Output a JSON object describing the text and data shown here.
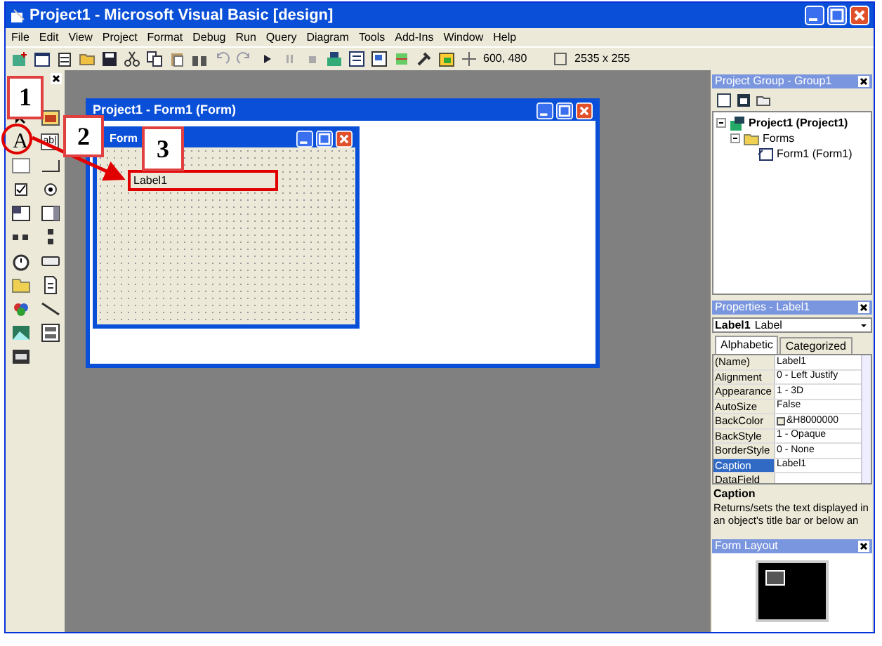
{
  "window": {
    "title": "Project1 - Microsoft Visual Basic [design]"
  },
  "menu": [
    "File",
    "Edit",
    "View",
    "Project",
    "Format",
    "Debug",
    "Run",
    "Query",
    "Diagram",
    "Tools",
    "Add-Ins",
    "Window",
    "Help"
  ],
  "toolbar": {
    "position": "600, 480",
    "size": "2535 x 255"
  },
  "toolbox": {
    "label_tool": "A",
    "textbox_tool": "ab|"
  },
  "designer": {
    "title": "Project1 - Form1 (Form)",
    "form": {
      "title": "Form",
      "label": "Label1"
    }
  },
  "project_group": {
    "title": "Project Group - Group1",
    "tree": [
      {
        "label": "Project1 (Project1)",
        "expanded": true,
        "children": [
          {
            "label": "Forms",
            "expanded": true,
            "children": [
              {
                "label": "Form1 (Form1)"
              }
            ]
          }
        ]
      }
    ]
  },
  "properties": {
    "title": "Properties - Label1",
    "object": "Label1",
    "object_type": "Label",
    "tabs": [
      {
        "label": "Alphabetic",
        "selected": true
      },
      {
        "label": "Categorized",
        "selected": false
      }
    ],
    "rows": [
      {
        "name": "(Name)",
        "value": "Label1",
        "kind": "text",
        "selected": false
      },
      {
        "name": "Alignment",
        "value": "0 - Left Justify",
        "kind": "text",
        "selected": false
      },
      {
        "name": "Appearance",
        "value": "1 - 3D",
        "kind": "text",
        "selected": false
      },
      {
        "name": "AutoSize",
        "value": "False",
        "kind": "text",
        "selected": false
      },
      {
        "name": "BackColor",
        "value": "&H8000000",
        "kind": "color",
        "selected": false
      },
      {
        "name": "BackStyle",
        "value": "1 - Opaque",
        "kind": "text",
        "selected": false
      },
      {
        "name": "BorderStyle",
        "value": "0 - None",
        "kind": "text",
        "selected": false
      },
      {
        "name": "Caption",
        "value": "Label1",
        "kind": "text",
        "selected": true
      },
      {
        "name": "DataField",
        "value": "",
        "kind": "text",
        "selected": false
      }
    ],
    "description_title": "Caption",
    "description": "Returns/sets the text displayed in an object's title bar or below an"
  },
  "form_layout": {
    "title": "Form Layout"
  },
  "annotations": [
    {
      "text": "1"
    },
    {
      "text": "2"
    },
    {
      "text": "3"
    }
  ]
}
